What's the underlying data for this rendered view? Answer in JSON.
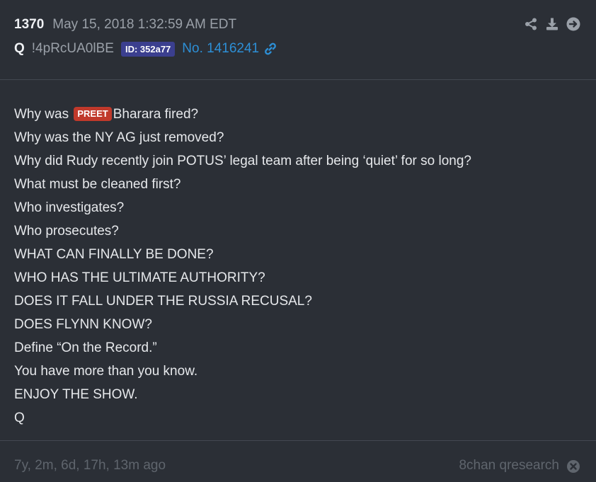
{
  "header": {
    "post_number": "1370",
    "timestamp": "May 15, 2018 1:32:59 AM EDT",
    "author": "Q",
    "tripcode": "!4pRcUA0lBE",
    "id_badge": "ID: 352a77",
    "post_link": "No. 1416241"
  },
  "actions": {
    "icons": [
      "share-icon",
      "download-icon",
      "arrow-right-circle-icon"
    ]
  },
  "post": {
    "line0_before": "Why was ",
    "line0_tag": "PREET",
    "line0_after": "Bharara fired?",
    "lines": [
      "Why was the NY AG just removed?",
      "Why did Rudy recently join POTUS’ legal team after being ‘quiet’ for so long?",
      "What must be cleaned first?",
      "Who investigates?",
      "Who prosecutes?",
      "WHAT CAN FINALLY BE DONE?",
      "WHO HAS THE ULTIMATE AUTHORITY?",
      "DOES IT FALL UNDER THE RUSSIA RECUSAL?",
      "DOES FLYNN KNOW?",
      "Define “On the Record.”",
      "You have more than you know.",
      "ENJOY THE SHOW.",
      "Q"
    ]
  },
  "footer": {
    "relative_time": "7y, 2m, 6d, 17h, 13m ago",
    "source": "8chan qresearch"
  },
  "colors": {
    "background": "#2b2f36",
    "tag_red": "#c0392b",
    "id_badge": "#3b3f8f",
    "link_blue": "#2d8fd6"
  }
}
